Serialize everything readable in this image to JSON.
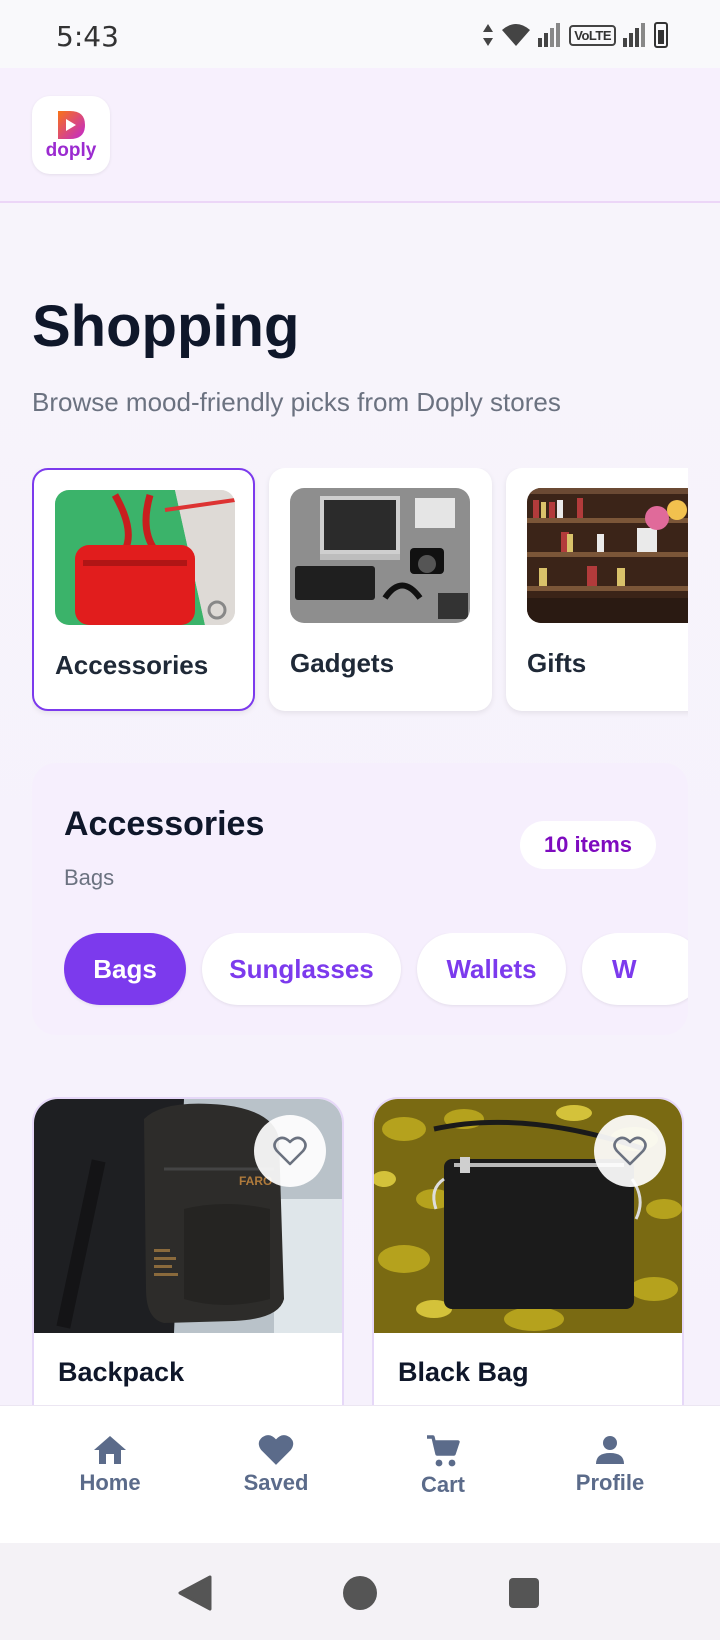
{
  "status_bar": {
    "time": "5:43",
    "network_label": "VoLTE"
  },
  "app": {
    "logo_text": "doply"
  },
  "page": {
    "title": "Shopping",
    "subtitle": "Browse mood-friendly picks from Doply stores"
  },
  "categories": [
    {
      "label": "Accessories",
      "selected": true
    },
    {
      "label": "Gadgets",
      "selected": false
    },
    {
      "label": "Gifts",
      "selected": false
    }
  ],
  "filter_panel": {
    "title": "Accessories",
    "subtitle": "Bags",
    "count": "10 items",
    "chips": [
      "Bags",
      "Sunglasses",
      "Wallets",
      "W"
    ]
  },
  "products": [
    {
      "name": "Backpack",
      "favorite_icon": "heart-outline-icon"
    },
    {
      "name": "Black Bag",
      "favorite_icon": "heart-outline-icon"
    }
  ],
  "bottom_nav": {
    "items": [
      {
        "label": "Home",
        "icon": "home-icon"
      },
      {
        "label": "Saved",
        "icon": "heart-icon"
      },
      {
        "label": "Cart",
        "icon": "cart-icon"
      },
      {
        "label": "Profile",
        "icon": "person-icon"
      }
    ]
  },
  "colors": {
    "accent": "#7c3aed",
    "badge_text": "#7e0bbf",
    "nav_icon": "#5b6b8a"
  }
}
